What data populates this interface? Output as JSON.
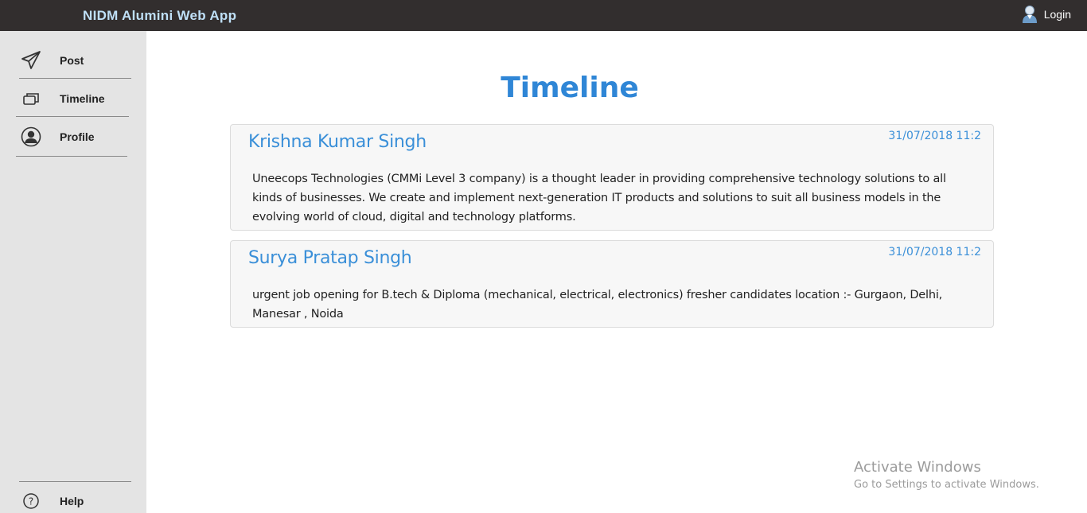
{
  "header": {
    "app_title": "NIDM Alumini Web App",
    "login_label": "Login"
  },
  "sidebar": {
    "items": [
      {
        "label": "Post",
        "icon": "paper-plane-icon"
      },
      {
        "label": "Timeline",
        "icon": "windows-stack-icon"
      },
      {
        "label": "Profile",
        "icon": "user-circle-icon"
      }
    ],
    "help_label": "Help"
  },
  "main": {
    "title": "Timeline",
    "posts": [
      {
        "author": "Krishna Kumar Singh",
        "timestamp": "31/07/2018 11:2",
        "body": "Uneecops Technologies (CMMi Level 3 company) is a thought leader in providing comprehensive technology solutions to all kinds of businesses. We create and implement next-generation IT products and solutions to suit all business models in the evolving world of cloud, digital and technology platforms."
      },
      {
        "author": "Surya Pratap Singh",
        "timestamp": "31/07/2018 11:2",
        "body": "urgent job opening for B.tech & Diploma (mechanical, electrical, electronics) fresher candidates location :- Gurgaon, Delhi, Manesar , Noida"
      }
    ]
  },
  "watermark": {
    "line1": "Activate Windows",
    "line2": "Go to Settings to activate Windows."
  },
  "colors": {
    "topbar": "#322e2e",
    "accent": "#2f86d6",
    "sidebar": "#e4e4e4"
  }
}
